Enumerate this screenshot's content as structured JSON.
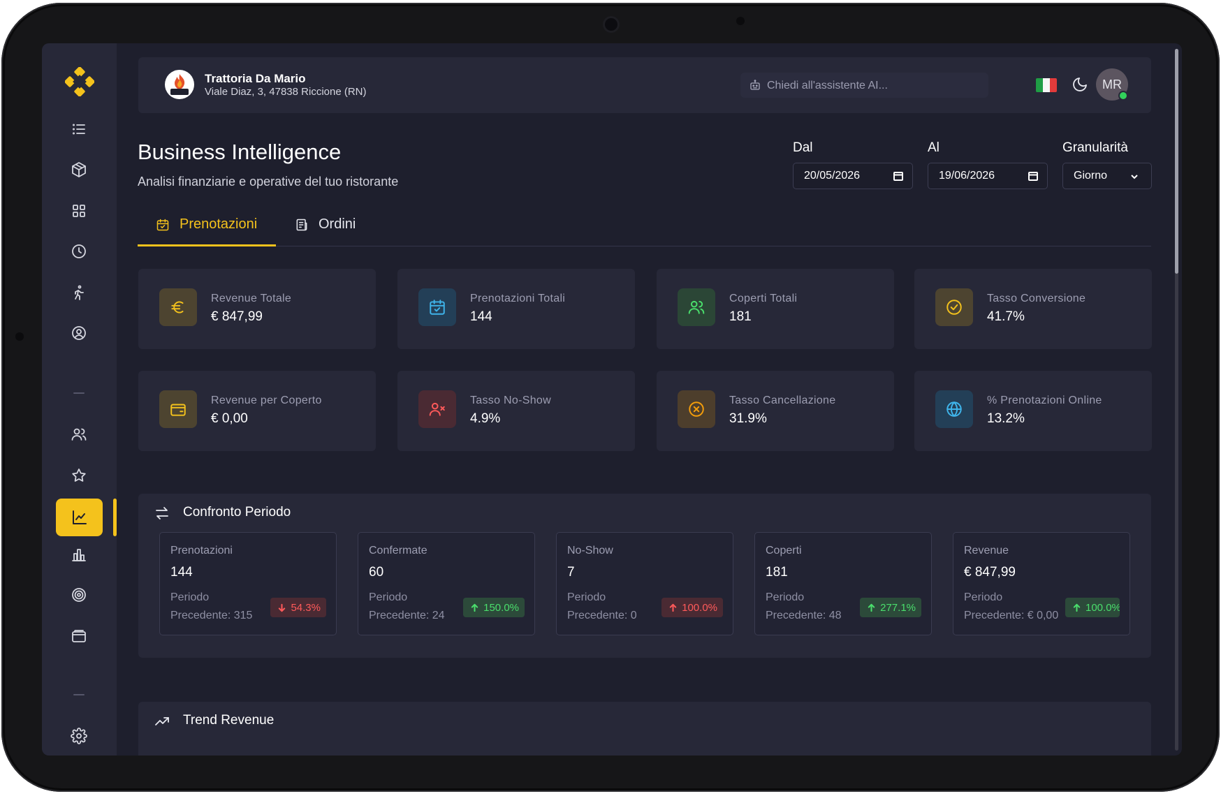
{
  "restaurant": {
    "name": "Trattoria Da Mario",
    "address": "Viale Diaz, 3, 47838 Riccione (RN)"
  },
  "topbar": {
    "ai_placeholder": "Chiedi all'assistente AI...",
    "avatar_initials": "MR",
    "language": "it-flag-icon"
  },
  "page": {
    "title": "Business Intelligence",
    "subtitle": "Analisi finanziarie e operative del tuo ristorante"
  },
  "filters": {
    "from": {
      "label": "Dal",
      "value": "20/05/2026"
    },
    "to": {
      "label": "Al",
      "value": "19/06/2026"
    },
    "granularity": {
      "label": "Granularità",
      "value": "Giorno"
    }
  },
  "tabs": [
    {
      "label": "Prenotazioni",
      "active": true
    },
    {
      "label": "Ordini",
      "active": false
    }
  ],
  "kpis": [
    {
      "label": "Revenue Totale",
      "value": "€ 847,99",
      "icon": "euro-icon"
    },
    {
      "label": "Prenotazioni Totali",
      "value": "144",
      "icon": "calendar-check-icon"
    },
    {
      "label": "Coperti Totali",
      "value": "181",
      "icon": "users-icon"
    },
    {
      "label": "Tasso Conversione",
      "value": "41.7%",
      "icon": "check-circle-icon"
    },
    {
      "label": "Revenue per Coperto",
      "value": "€ 0,00",
      "icon": "wallet-icon"
    },
    {
      "label": "Tasso No-Show",
      "value": "4.9%",
      "icon": "user-x-icon"
    },
    {
      "label": "Tasso Cancellazione",
      "value": "31.9%",
      "icon": "x-circle-icon"
    },
    {
      "label": "% Prenotazioni Online",
      "value": "13.2%",
      "icon": "globe-icon"
    }
  ],
  "comparison": {
    "title": "Confronto Periodo",
    "prev_label": "Periodo",
    "items": [
      {
        "label": "Prenotazioni",
        "value": "144",
        "previous": "Precedente: 315",
        "change": "54.3%",
        "direction": "down"
      },
      {
        "label": "Confermate",
        "value": "60",
        "previous": "Precedente: 24",
        "change": "150.0%",
        "direction": "up"
      },
      {
        "label": "No-Show",
        "value": "7",
        "previous": "Precedente: 0",
        "change": "100.0%",
        "direction": "down"
      },
      {
        "label": "Coperti",
        "value": "181",
        "previous": "Precedente: 48",
        "change": "277.1%",
        "direction": "up"
      },
      {
        "label": "Revenue",
        "value": "€ 847,99",
        "previous": "Precedente: € 0,00",
        "change": "100.0%",
        "direction": "up"
      }
    ]
  },
  "trend": {
    "title": "Trend Revenue"
  },
  "sidebar": {
    "items": [
      "list-icon",
      "box-icon",
      "grid-icon",
      "clock-icon",
      "activity-walk-icon",
      "user-circle-icon",
      "users-icon",
      "star-icon",
      "chart-line-icon",
      "bar-chart-icon",
      "target-icon",
      "wallet-icon",
      "settings-icon"
    ],
    "active": "chart-line-icon"
  },
  "colors": {
    "accent": "#f4c21c",
    "background": "#1e1f2d",
    "card": "#272838",
    "up": "#4ade6c",
    "down": "#ff5a5a"
  }
}
